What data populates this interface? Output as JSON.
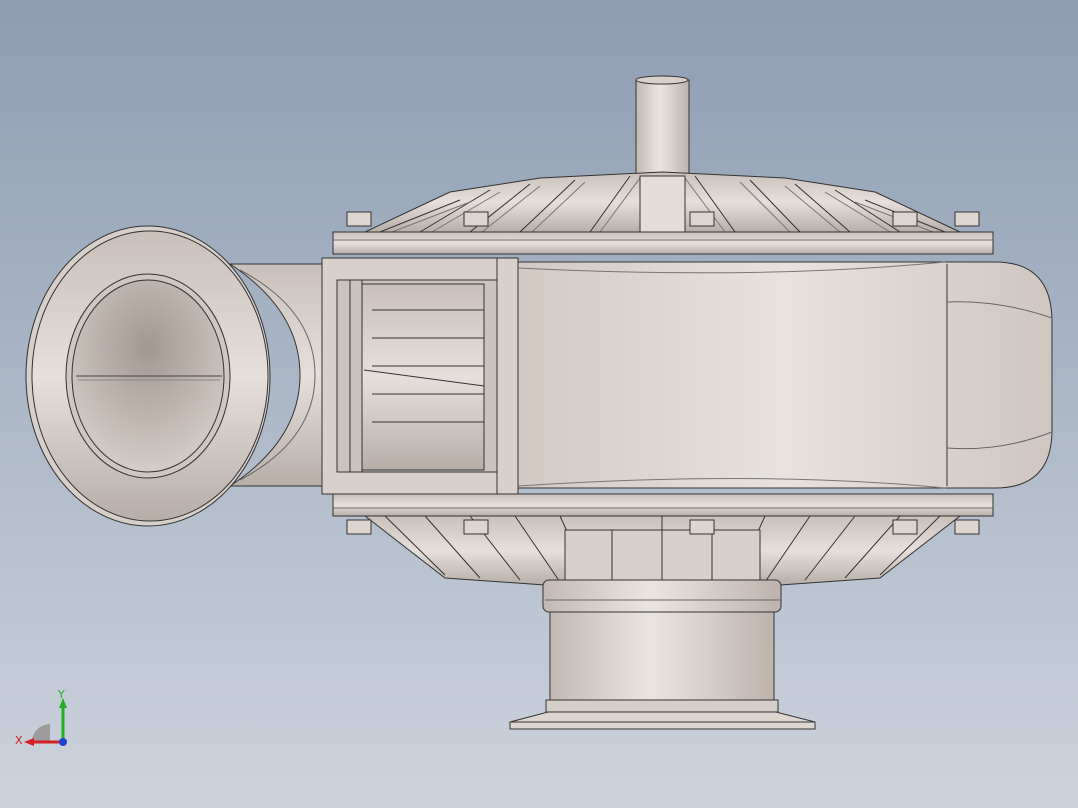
{
  "viewport": {
    "background_top": "#8d9db3",
    "background_bottom": "#cdd3dc",
    "model_color": "#d9d1cb"
  },
  "triad": {
    "x_label": "X",
    "y_label": "Y",
    "x_color": "#d42020",
    "y_color": "#20b020",
    "z_color": "#2040d0"
  }
}
